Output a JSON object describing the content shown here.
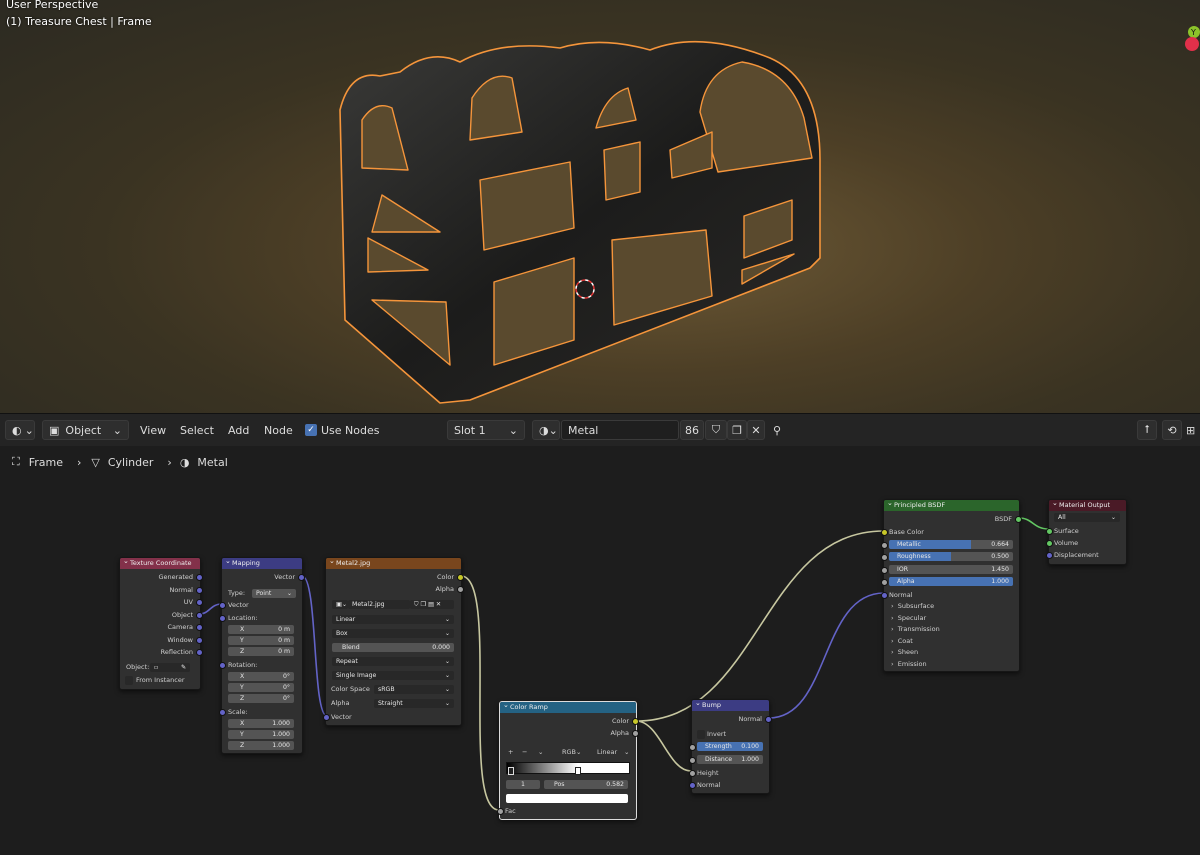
{
  "viewport": {
    "perspective_label": "User Perspective",
    "object_label": "(1) Treasure Chest | Frame",
    "gizmo_y": "Y"
  },
  "header": {
    "mode": "Object",
    "menu": [
      "View",
      "Select",
      "Add",
      "Node"
    ],
    "use_nodes_label": "Use Nodes",
    "slot": "Slot 1",
    "material_name": "Metal",
    "users": "86"
  },
  "breadcrumb": {
    "items": [
      "Frame",
      "Cylinder",
      "Metal"
    ]
  },
  "nodes": {
    "texcoord": {
      "title": "Texture Coordinate",
      "outputs": [
        "Generated",
        "Normal",
        "UV",
        "Object",
        "Camera",
        "Window",
        "Reflection"
      ],
      "object_label": "Object:",
      "from_instancer": "From Instancer"
    },
    "mapping": {
      "title": "Mapping",
      "output": "Vector",
      "type_label": "Type:",
      "type_value": "Point",
      "input_vector": "Vector",
      "location_label": "Location:",
      "location": [
        [
          "X",
          "0 m"
        ],
        [
          "Y",
          "0 m"
        ],
        [
          "Z",
          "0 m"
        ]
      ],
      "rotation_label": "Rotation:",
      "rotation": [
        [
          "X",
          "0°"
        ],
        [
          "Y",
          "0°"
        ],
        [
          "Z",
          "0°"
        ]
      ],
      "scale_label": "Scale:",
      "scale": [
        [
          "X",
          "1.000"
        ],
        [
          "Y",
          "1.000"
        ],
        [
          "Z",
          "1.000"
        ]
      ]
    },
    "image": {
      "title": "Metal2.jpg",
      "out_color": "Color",
      "out_alpha": "Alpha",
      "image_name": "Metal2.jpg",
      "interpolation": "Linear",
      "projection": "Box",
      "blend_label": "Blend",
      "blend_value": "0.000",
      "extension": "Repeat",
      "source": "Single Image",
      "color_space_label": "Color Space",
      "color_space": "sRGB",
      "alpha_label": "Alpha",
      "alpha_value": "Straight",
      "input_vector": "Vector"
    },
    "ramp": {
      "title": "Color Ramp",
      "out_color": "Color",
      "out_alpha": "Alpha",
      "plus": "+",
      "minus": "−",
      "color_mode": "RGB",
      "interp": "Linear",
      "index": "1",
      "pos_label": "Pos",
      "pos_value": "0.582",
      "input_fac": "Fac"
    },
    "bump": {
      "title": "Bump",
      "output": "Normal",
      "invert": "Invert",
      "strength_label": "Strength",
      "strength_value": "0.100",
      "distance_label": "Distance",
      "distance_value": "1.000",
      "height": "Height",
      "normal": "Normal"
    },
    "bsdf": {
      "title": "Principled BSDF",
      "output": "BSDF",
      "base_color": "Base Color",
      "metallic_label": "Metallic",
      "metallic_value": "0.664",
      "metallic_fill": 0.664,
      "roughness_label": "Roughness",
      "roughness_value": "0.500",
      "roughness_fill": 0.5,
      "ior_label": "IOR",
      "ior_value": "1.450",
      "alpha_label": "Alpha",
      "alpha_value": "1.000",
      "alpha_fill": 1.0,
      "normal": "Normal",
      "panels": [
        "Subsurface",
        "Specular",
        "Transmission",
        "Coat",
        "Sheen",
        "Emission"
      ]
    },
    "output": {
      "title": "Material Output",
      "target": "All",
      "inputs": [
        "Surface",
        "Volume",
        "Displacement"
      ]
    }
  },
  "colors": {
    "texcoord_header": "#83314a",
    "mapping_header": "#3c3c83",
    "image_header": "#79461d",
    "ramp_header": "#246283",
    "bump_header": "#3c3c83",
    "bsdf_header": "#2b652b",
    "output_header": "#4a1a26",
    "selection_outline": "#f5953b"
  }
}
